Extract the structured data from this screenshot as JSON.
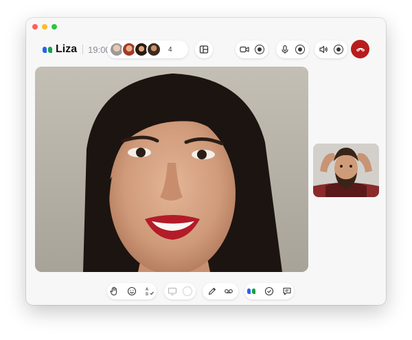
{
  "window": {
    "traffic_lights": [
      "close",
      "minimize",
      "maximize"
    ]
  },
  "header": {
    "brand": "Liza",
    "time": "19:00",
    "participants": {
      "count": "4",
      "avatars": [
        "participant-1",
        "participant-2",
        "participant-3",
        "participant-4"
      ]
    }
  },
  "controls": {
    "layout": {
      "icon": "layout-panel-icon"
    },
    "camera": {
      "icon": "video-camera-icon",
      "state": "on"
    },
    "microphone": {
      "icon": "microphone-icon",
      "state": "on"
    },
    "speaker": {
      "icon": "speaker-icon",
      "state": "on"
    },
    "hangup": {
      "icon": "phone-hangup-icon",
      "color": "#b91c1c"
    }
  },
  "toolbar": {
    "groups": [
      {
        "name": "reactions",
        "items": [
          "hand-icon",
          "emoji-icon",
          "translate-icon"
        ]
      },
      {
        "name": "screen",
        "items": [
          "screen-share-icon",
          "record-toggle"
        ]
      },
      {
        "name": "notes",
        "items": [
          "pen-icon",
          "voicemail-icon"
        ]
      },
      {
        "name": "assistant",
        "items": [
          "quote-logo-icon",
          "checkmark-icon",
          "chat-icon"
        ]
      }
    ]
  },
  "colors": {
    "brand_blue": "#2563eb",
    "brand_green": "#16a34a",
    "hangup_red": "#b91c1c",
    "window_bg": "#f7f7f8"
  }
}
